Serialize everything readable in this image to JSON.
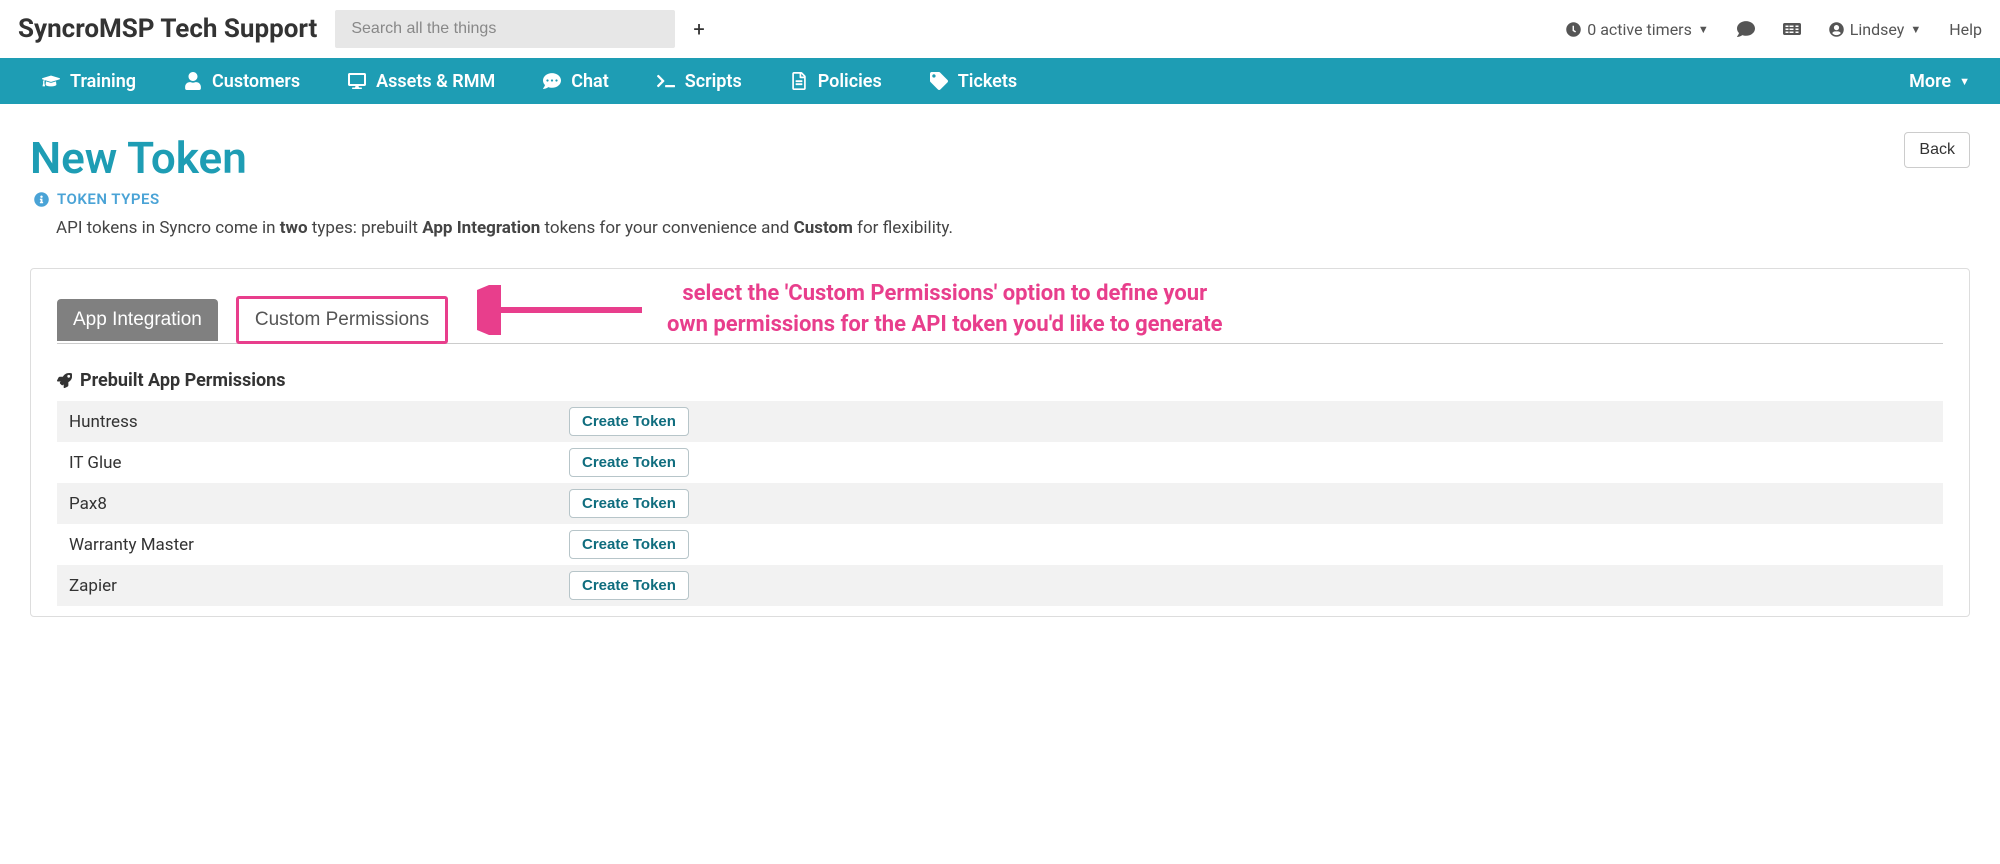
{
  "topbar": {
    "app_title": "SyncroMSP Tech Support",
    "search_placeholder": "Search all the things",
    "timers_label": "0 active timers",
    "user_name": "Lindsey",
    "help_label": "Help"
  },
  "nav": {
    "items": [
      {
        "label": "Training"
      },
      {
        "label": "Customers"
      },
      {
        "label": "Assets & RMM"
      },
      {
        "label": "Chat"
      },
      {
        "label": "Scripts"
      },
      {
        "label": "Policies"
      },
      {
        "label": "Tickets"
      }
    ],
    "more_label": "More"
  },
  "page": {
    "title": "New Token",
    "back_label": "Back",
    "token_types_label": "TOKEN TYPES",
    "desc_prefix": "API tokens in Syncro come in ",
    "desc_two": "two",
    "desc_mid": " types: prebuilt ",
    "desc_app_int": "App Integration",
    "desc_mid2": " tokens for your convenience and ",
    "desc_custom": "Custom",
    "desc_suffix": " for flexibility."
  },
  "tabs": {
    "app_integration": "App Integration",
    "custom_permissions": "Custom Permissions"
  },
  "annotation": "select the 'Custom Permissions' option to define your\nown permissions for the API token you'd like to generate",
  "section": {
    "title": "Prebuilt App Permissions"
  },
  "permissions": [
    {
      "name": "Huntress",
      "button": "Create Token"
    },
    {
      "name": "IT Glue",
      "button": "Create Token"
    },
    {
      "name": "Pax8",
      "button": "Create Token"
    },
    {
      "name": "Warranty Master",
      "button": "Create Token"
    },
    {
      "name": "Zapier",
      "button": "Create Token"
    }
  ]
}
